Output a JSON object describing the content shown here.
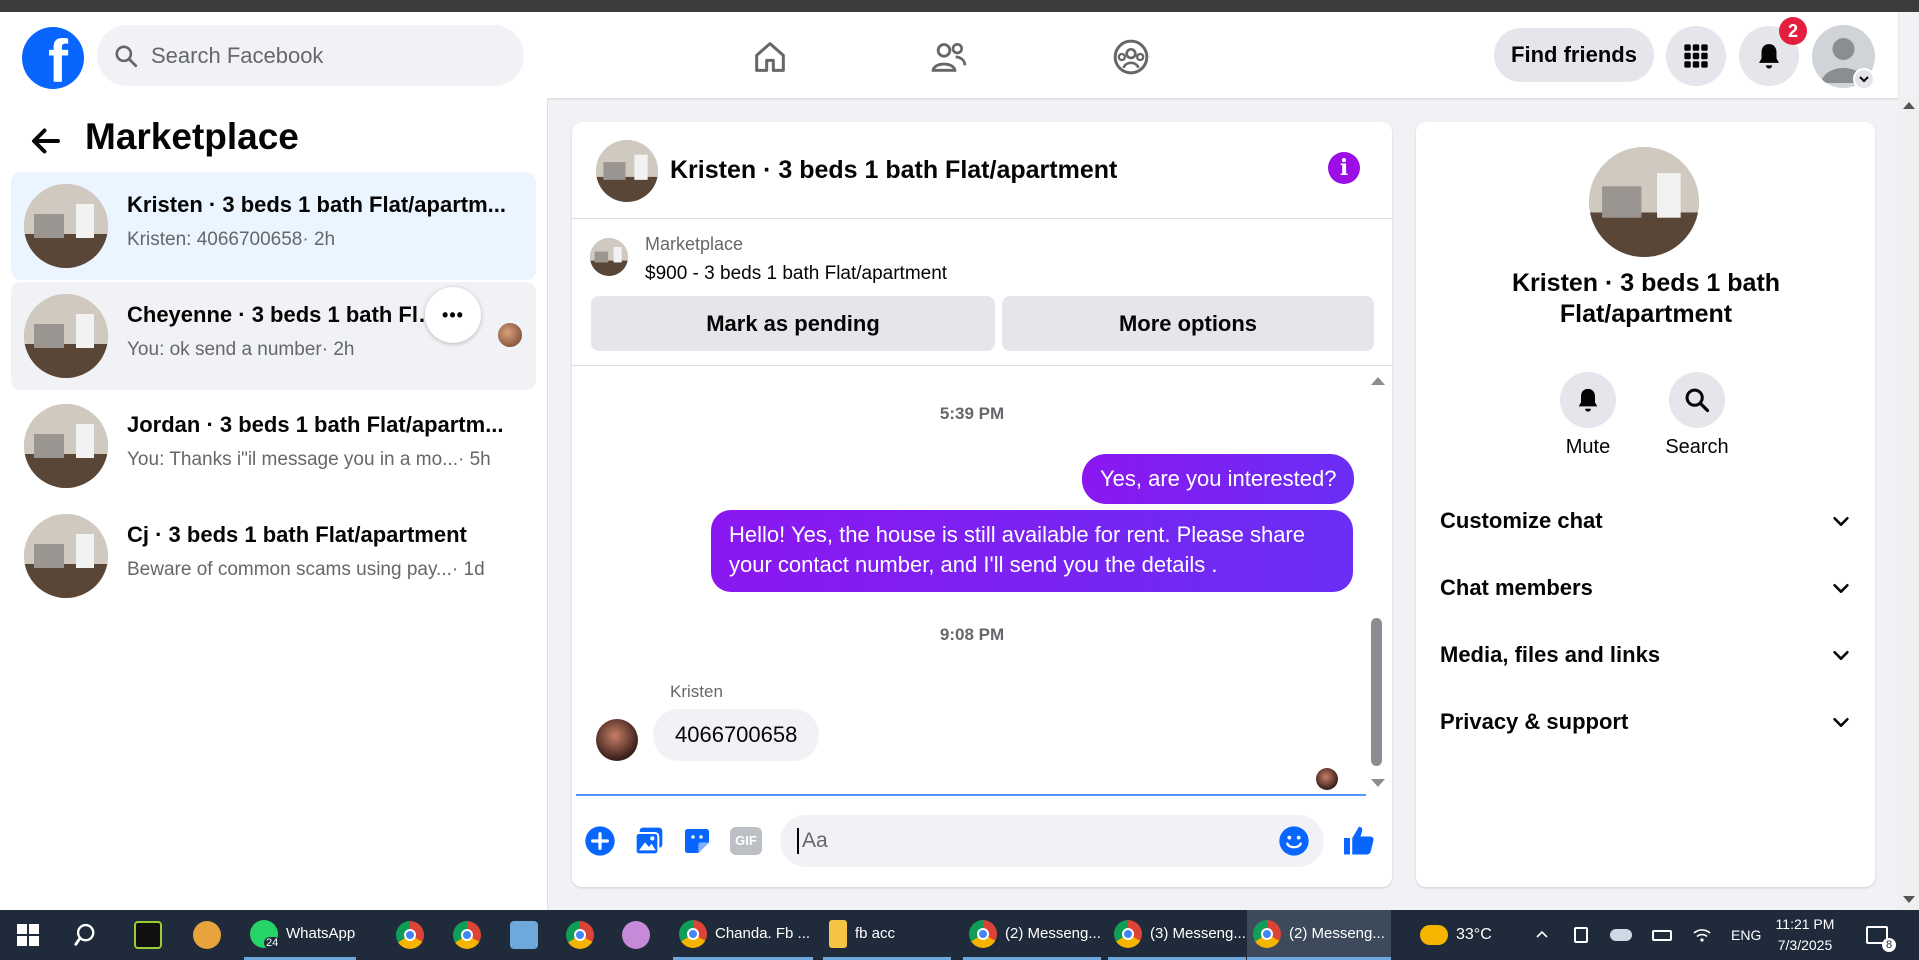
{
  "topbar": {
    "logo": "f",
    "search_placeholder": "Search Facebook",
    "find_friends_label": "Find friends",
    "notification_count": "2"
  },
  "left": {
    "title": "Marketplace",
    "conversations": [
      {
        "name": "Kristen · 3 beds 1 bath Flat/apartm...",
        "preview": "Kristen: 4066700658",
        "time": "· 2h"
      },
      {
        "name": "Cheyenne · 3 beds 1 bath Flat/a",
        "preview": "You: ok send a number",
        "time": "· 2h"
      },
      {
        "name": "Jordan · 3 beds 1 bath Flat/apartm...",
        "preview": "You: Thanks i\"il message you in a mo...",
        "time": "· 5h"
      },
      {
        "name": "Cj · 3 beds 1 bath Flat/apartment",
        "preview": "Beware of common scams using pay...",
        "time": "· 1d"
      }
    ],
    "more_dots": "•••"
  },
  "chat": {
    "title": "Kristen · 3 beds 1 bath Flat/apartment",
    "info_icon": "i",
    "listing_label": "Marketplace",
    "listing_price": "$900 - 3 beds 1 bath Flat/apartment",
    "mark_pending": "Mark as pending",
    "more_options": "More options",
    "time1": "5:39 PM",
    "out_msg1": "Yes, are you interested?",
    "out_msg2": "Hello! Yes, the house is still available for rent. Please share your contact number, and I'll send you the details .",
    "time2": "9:08 PM",
    "sender": "Kristen",
    "in_msg": "4066700658",
    "composer_placeholder": "Aa",
    "gif_label": "GIF"
  },
  "right": {
    "title": "Kristen · 3 beds 1 bath Flat/apartment",
    "mute": "Mute",
    "search": "Search",
    "rows": [
      "Customize chat",
      "Chat members",
      "Media, files and links",
      "Privacy & support"
    ]
  },
  "taskbar": {
    "whatsapp_badge": "24",
    "whatsapp": "WhatsApp",
    "chanda": "Chanda. Fb ...",
    "fbacc": "fb acc",
    "msg2a": "(2) Messeng...",
    "msg3": "(3) Messeng...",
    "msg2b": "(2) Messeng...",
    "temp": "33°C",
    "lang": "ENG",
    "time": "11:21 PM",
    "date": "7/3/2025",
    "notif_count": "8"
  },
  "colors": {
    "fb_blue": "#0866ff",
    "messenger_purple": "#8b17f0",
    "badge_red": "#e41e3f"
  }
}
